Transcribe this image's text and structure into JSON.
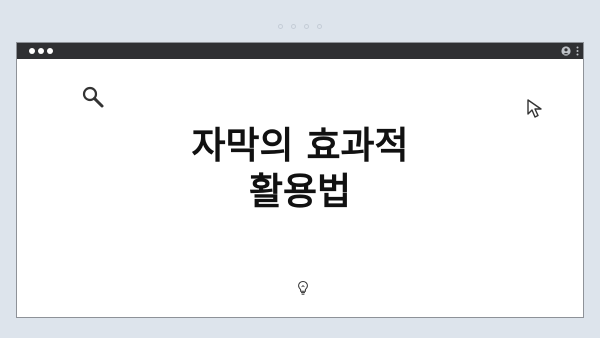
{
  "slide": {
    "title_line1": "자막의 효과적",
    "title_line2": "활용법"
  },
  "icons": {
    "search": "search-icon",
    "cursor": "cursor-arrow-icon",
    "lightbulb": "lightbulb-icon",
    "user": "user-icon",
    "menu": "kebab-menu-icon"
  },
  "colors": {
    "background": "#dde4ec",
    "card": "#ffffff",
    "titlebar": "#2f3033",
    "text": "#111111"
  }
}
